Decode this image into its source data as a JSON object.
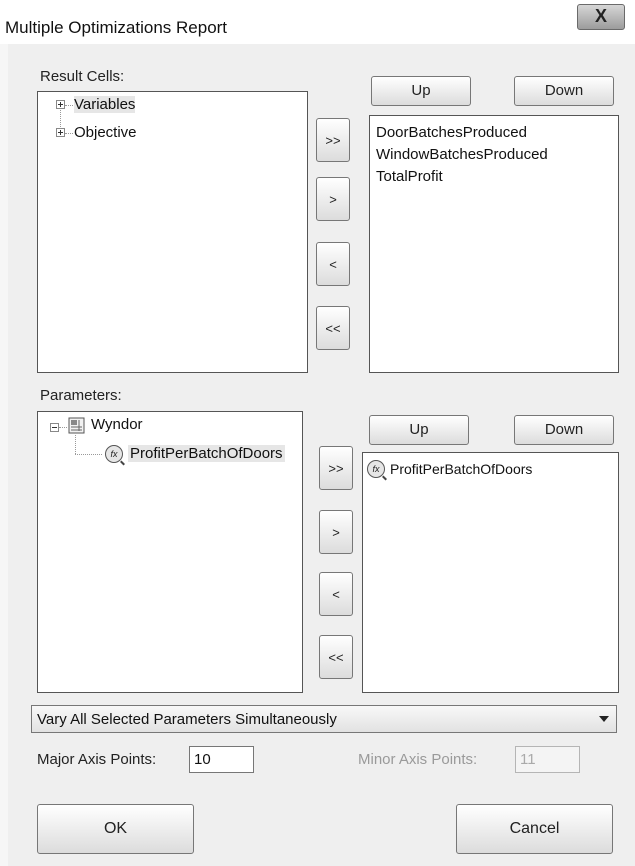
{
  "window": {
    "title": "Multiple Optimizations Report",
    "close_label": "X"
  },
  "result_cells": {
    "label": "Result Cells:",
    "tree": [
      {
        "label": "Variables"
      },
      {
        "label": "Objective"
      }
    ],
    "up_label": "Up",
    "down_label": "Down",
    "selected": [
      "DoorBatchesProduced",
      "WindowBatchesProduced",
      "TotalProfit"
    ]
  },
  "parameters": {
    "label": "Parameters:",
    "tree_root": "Wyndor",
    "tree_child": "ProfitPerBatchOfDoors",
    "up_label": "Up",
    "down_label": "Down",
    "selected": [
      "ProfitPerBatchOfDoors"
    ]
  },
  "transfer_buttons": {
    "add_all": ">>",
    "add": ">",
    "remove": "<",
    "remove_all": "<<"
  },
  "icons": {
    "fx": "fx-icon",
    "workbook": "workbook-icon"
  },
  "vary_mode": {
    "selected": "Vary All Selected Parameters Simultaneously"
  },
  "major_axis": {
    "label": "Major Axis Points:",
    "value": "10"
  },
  "minor_axis": {
    "label": "Minor Axis Points:",
    "value": "11"
  },
  "ok_label": "OK",
  "cancel_label": "Cancel"
}
